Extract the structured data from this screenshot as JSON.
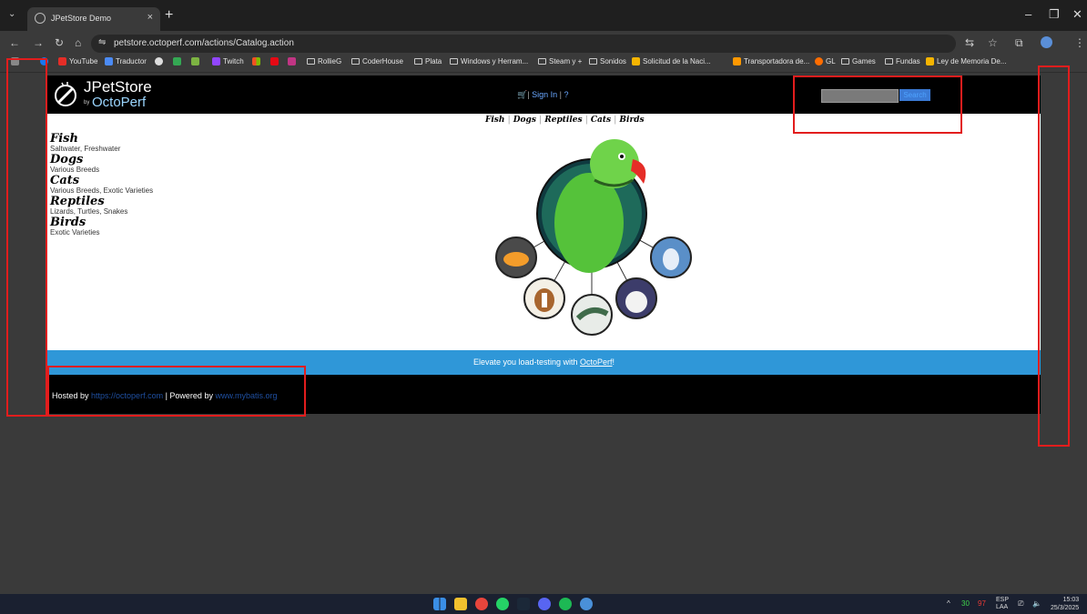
{
  "browser": {
    "tab_title": "JPetStore Demo",
    "tab_close": "×",
    "new_tab": "+",
    "tab_menu": "⌄",
    "url": "petstore.octoperf.com/actions/Catalog.action",
    "bookmarks": [
      "YouTube",
      "Traductor",
      "Twitch",
      "RollieG",
      "CoderHouse",
      "Plata",
      "Windows y Herram...",
      "Steam y +",
      "Sonidos",
      "Solicitud de la Naci...",
      "Transportadora de...",
      "GL",
      "Games",
      "Fundas",
      "Ley de Memoria De..."
    ]
  },
  "site": {
    "logo_jpet": "JPetStore",
    "logo_by": "by",
    "logo_octo": "OctoPerf",
    "signin": "Sign In",
    "help": "?",
    "search_button": "Search",
    "quicklinks": [
      "Fish",
      "Dogs",
      "Reptiles",
      "Cats",
      "Birds"
    ],
    "categories": [
      {
        "name": "Fish",
        "desc": "Saltwater, Freshwater"
      },
      {
        "name": "Dogs",
        "desc": "Various Breeds"
      },
      {
        "name": "Cats",
        "desc": "Various Breeds, Exotic Varieties"
      },
      {
        "name": "Reptiles",
        "desc": "Lizards, Turtles, Snakes"
      },
      {
        "name": "Birds",
        "desc": "Exotic Varieties"
      }
    ],
    "banner_text": "Elevate you load-testing with ",
    "banner_link": "OctoPerf",
    "banner_end": "!",
    "footer_hosted": "Hosted by ",
    "footer_hosted_link": "https://octoperf.com",
    "footer_powered": " | Powered by ",
    "footer_powered_link": "www.mybatis.org"
  },
  "taskbar": {
    "tray_lang": "ESP",
    "tray_lang2": "LAA",
    "tray_num1": "30",
    "tray_num2": "97",
    "time": "15:03",
    "date": "25/3/2025"
  },
  "colors": {
    "accent": "#2f97d8",
    "annotation": "#e21d1d"
  }
}
